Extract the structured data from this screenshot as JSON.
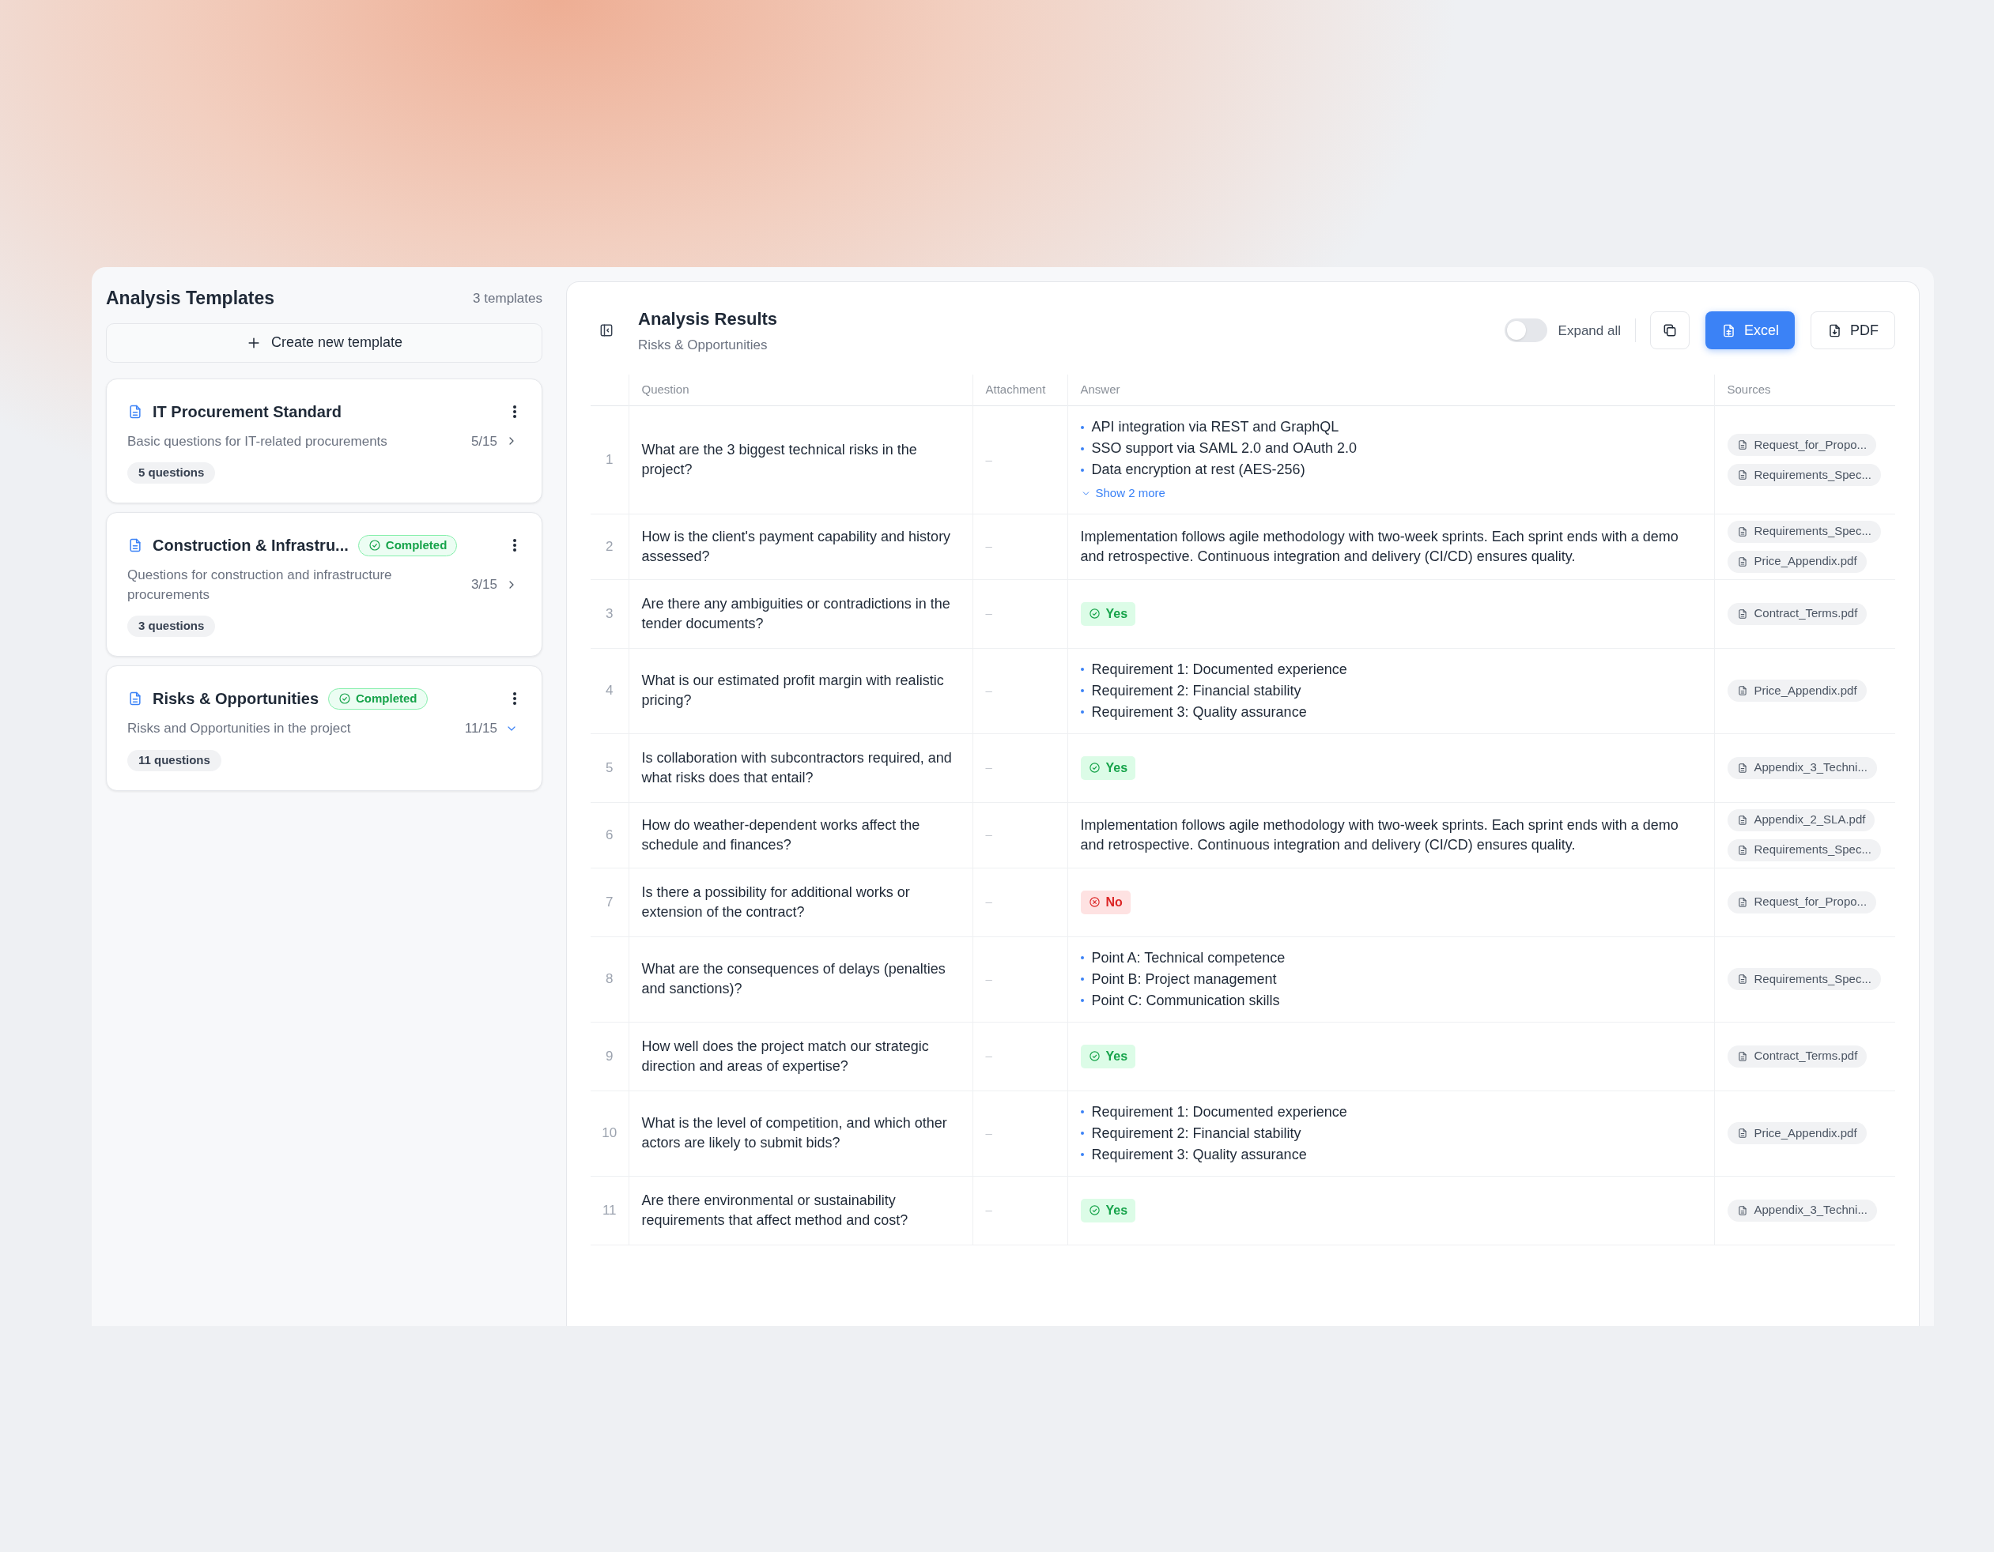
{
  "sidebar": {
    "title": "Analysis Templates",
    "count": "3 templates",
    "create_button": "Create new template",
    "templates": [
      {
        "title": "IT Procurement Standard",
        "description": "Basic questions for IT-related procurements",
        "progress": "5/15",
        "questions": "5 questions",
        "expanded": false
      },
      {
        "title": "Construction & Infrastru...",
        "badge": "Completed",
        "description": "Questions for construction and infrastructure procurements",
        "progress": "3/15",
        "questions": "3 questions",
        "expanded": false
      },
      {
        "title": "Risks & Opportunities",
        "badge": "Completed",
        "description": "Risks and Opportunities in the project",
        "progress": "11/15",
        "questions": "11 questions",
        "expanded": true
      }
    ]
  },
  "results": {
    "title": "Analysis Results",
    "subtitle": "Risks & Opportunities",
    "expand_all": {
      "label": "Expand all",
      "on": false
    },
    "buttons": [
      "Excel",
      "PDF"
    ],
    "table": {
      "columns": [
        "Question",
        "Attachment",
        "Answer",
        "Sources"
      ],
      "rows": [
        {
          "number": "1",
          "question": "What are the 3 biggest technical risks in the project?",
          "attachment": "–",
          "answer": {
            "kind": "bullets",
            "items": [
              "API integration via REST and GraphQL",
              "SSO support via SAML 2.0 and OAuth 2.0",
              "Data encryption at rest (AES-256)"
            ],
            "more": "Show 2 more"
          },
          "sources": [
            "Request_for_Propo...",
            "Requirements_Spec..."
          ]
        },
        {
          "number": "2",
          "question": "How is the client's payment capability and history assessed?",
          "attachment": "–",
          "answer": {
            "kind": "text",
            "text": "Implementation follows agile methodology with two-week sprints. Each sprint ends with a demo and retrospective. Continuous integration and delivery (CI/CD) ensures quality."
          },
          "sources": [
            "Requirements_Spec...",
            "Price_Appendix.pdf"
          ]
        },
        {
          "number": "3",
          "question": "Are there any ambiguities or contradictions in the tender documents?",
          "attachment": "–",
          "answer": {
            "kind": "yes",
            "text": "Yes"
          },
          "sources": [
            "Contract_Terms.pdf"
          ]
        },
        {
          "number": "4",
          "question": "What is our estimated profit margin with realistic pricing?",
          "attachment": "–",
          "answer": {
            "kind": "bullets",
            "items": [
              "Requirement 1: Documented experience",
              "Requirement 2: Financial stability",
              "Requirement 3: Quality assurance"
            ]
          },
          "sources": [
            "Price_Appendix.pdf"
          ]
        },
        {
          "number": "5",
          "question": "Is collaboration with subcontractors required, and what risks does that entail?",
          "attachment": "–",
          "answer": {
            "kind": "yes",
            "text": "Yes"
          },
          "sources": [
            "Appendix_3_Techni..."
          ]
        },
        {
          "number": "6",
          "question": "How do weather-dependent works affect the schedule and finances?",
          "attachment": "–",
          "answer": {
            "kind": "text",
            "text": "Implementation follows agile methodology with two-week sprints. Each sprint ends with a demo and retrospective. Continuous integration and delivery (CI/CD) ensures quality."
          },
          "sources": [
            "Appendix_2_SLA.pdf",
            "Requirements_Spec..."
          ]
        },
        {
          "number": "7",
          "question": "Is there a possibility for additional works or extension of the contract?",
          "attachment": "–",
          "answer": {
            "kind": "no",
            "text": "No"
          },
          "sources": [
            "Request_for_Propo..."
          ]
        },
        {
          "number": "8",
          "question": "What are the consequences of delays (penalties and sanctions)?",
          "attachment": "–",
          "answer": {
            "kind": "bullets",
            "items": [
              "Point A: Technical competence",
              "Point B: Project management",
              "Point C: Communication skills"
            ]
          },
          "sources": [
            "Requirements_Spec..."
          ]
        },
        {
          "number": "9",
          "question": "How well does the project match our strategic direction and areas of expertise?",
          "attachment": "–",
          "answer": {
            "kind": "yes",
            "text": "Yes"
          },
          "sources": [
            "Contract_Terms.pdf"
          ]
        },
        {
          "number": "10",
          "question": "What is the level of competition, and which other actors are likely to submit bids?",
          "attachment": "–",
          "answer": {
            "kind": "bullets",
            "items": [
              "Requirement 1: Documented experience",
              "Requirement 2: Financial stability",
              "Requirement 3: Quality assurance"
            ]
          },
          "sources": [
            "Price_Appendix.pdf"
          ]
        },
        {
          "number": "11",
          "question": "Are there environmental or sustainability requirements that affect method and cost?",
          "attachment": "–",
          "answer": {
            "kind": "yes",
            "text": "Yes"
          },
          "sources": [
            "Appendix_3_Techni..."
          ]
        }
      ]
    }
  }
}
